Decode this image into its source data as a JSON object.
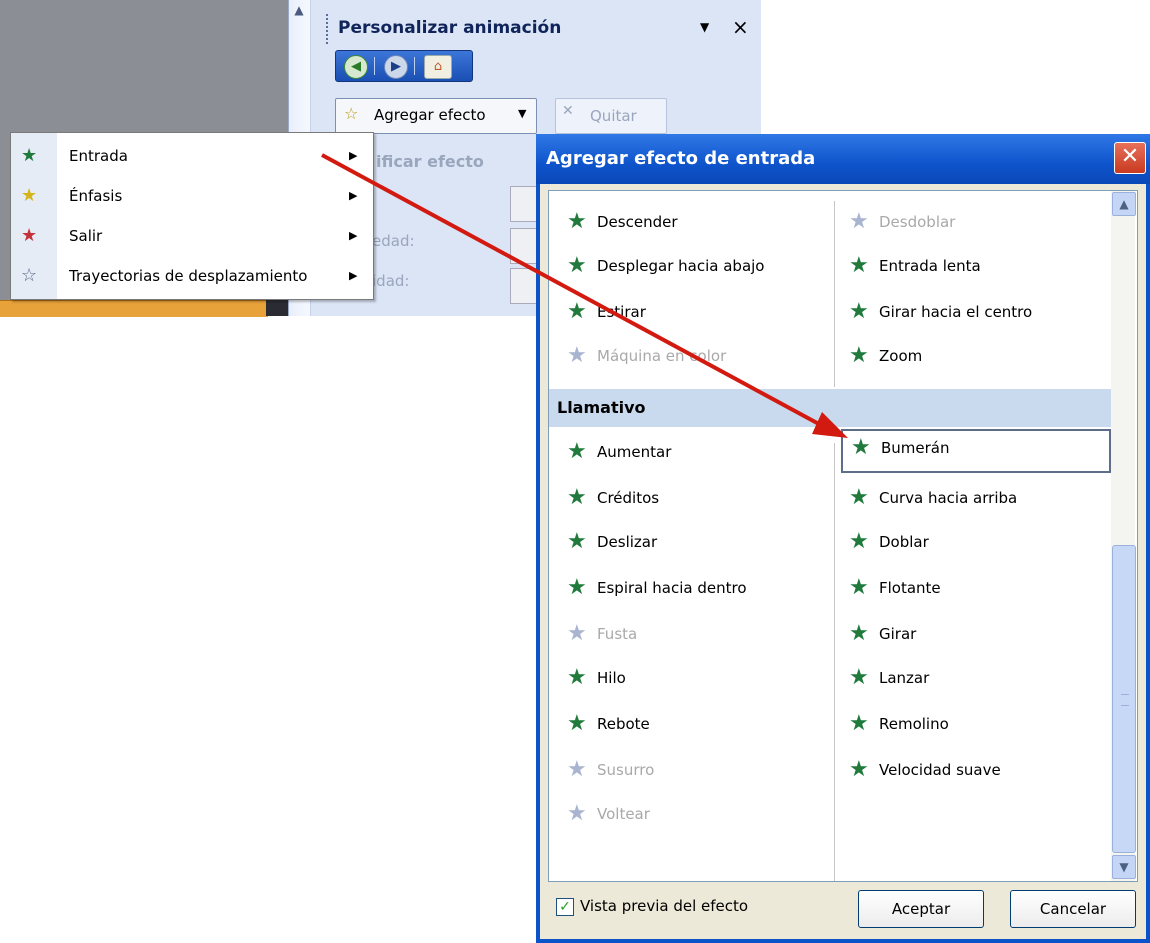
{
  "task_pane": {
    "title": "Personalizar animación",
    "dropdown_icon": "▼",
    "close_icon": "×",
    "nav": {
      "back_icon": "back-arrow-icon",
      "forward_icon": "forward-arrow-icon",
      "home_icon": "home-icon"
    },
    "add_effect_label": "Agregar efecto",
    "remove_label": "Quitar",
    "modify_label": "ificar efecto",
    "field1_label": "edad:",
    "field2_label": "idad:"
  },
  "context_menu": {
    "items": [
      {
        "label": "Entrada",
        "icon": "green-star-icon",
        "color": "#1e7a3a"
      },
      {
        "label": "Énfasis",
        "icon": "yellow-star-icon",
        "color": "#d6b41c"
      },
      {
        "label": "Salir",
        "icon": "red-star-icon",
        "color": "#c4323a"
      },
      {
        "label": "Trayectorias de desplazamiento",
        "icon": "outline-star-icon",
        "color": "#5a6a8a"
      }
    ]
  },
  "dialog": {
    "title": "Agregar efecto de entrada",
    "close_icon": "✕",
    "section_title": "Llamativo",
    "top_left": [
      {
        "label": "Descender",
        "disabled": false
      },
      {
        "label": "Desplegar hacia abajo",
        "disabled": false
      },
      {
        "label": "Estirar",
        "disabled": false
      },
      {
        "label": "Máquina en color",
        "disabled": true
      }
    ],
    "top_right": [
      {
        "label": "Desdoblar",
        "disabled": true
      },
      {
        "label": "Entrada lenta",
        "disabled": false
      },
      {
        "label": "Girar hacia el centro",
        "disabled": false
      },
      {
        "label": "Zoom",
        "disabled": false
      }
    ],
    "llamativo_left": [
      {
        "label": "Aumentar",
        "disabled": false
      },
      {
        "label": "Créditos",
        "disabled": false
      },
      {
        "label": "Deslizar",
        "disabled": false
      },
      {
        "label": "Espiral hacia dentro",
        "disabled": false
      },
      {
        "label": "Fusta",
        "disabled": true
      },
      {
        "label": "Hilo",
        "disabled": false
      },
      {
        "label": "Rebote",
        "disabled": false
      },
      {
        "label": "Susurro",
        "disabled": true
      },
      {
        "label": "Voltear",
        "disabled": true
      }
    ],
    "llamativo_right": [
      {
        "label": "Bumerán",
        "disabled": false,
        "selected": true
      },
      {
        "label": "Curva hacia arriba",
        "disabled": false
      },
      {
        "label": "Doblar",
        "disabled": false
      },
      {
        "label": "Flotante",
        "disabled": false
      },
      {
        "label": "Girar",
        "disabled": false
      },
      {
        "label": "Lanzar",
        "disabled": false
      },
      {
        "label": "Remolino",
        "disabled": false
      },
      {
        "label": "Velocidad suave",
        "disabled": false
      }
    ],
    "preview_label": "Vista previa del efecto",
    "preview_checked": true,
    "ok_label": "Aceptar",
    "cancel_label": "Cancelar"
  },
  "colors": {
    "star_green": "#1f7a3c",
    "arrow_red": "#d21a10",
    "dialog_blue": "#0a53c8"
  }
}
